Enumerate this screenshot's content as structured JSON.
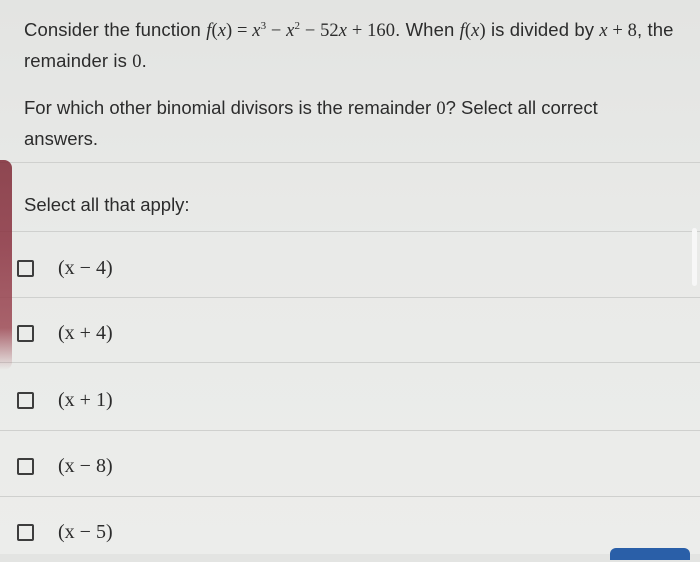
{
  "question": {
    "intro": "Consider the function",
    "function": "f(x) = x³ − x² − 52x + 160",
    "when": "When",
    "fx": "f(x)",
    "is_divided_by": "is divided",
    "by": "by",
    "divisor": "x + 8",
    "remainder_text": ", the remainder is",
    "zero": "0",
    "prompt_start": "For which other binomial divisors is the remainder",
    "prompt_zero": "0",
    "prompt_end": "? Select all correct answers."
  },
  "instruction": "Select all that apply:",
  "options": [
    {
      "label": "(x − 4)",
      "checked": false
    },
    {
      "label": "(x + 4)",
      "checked": false
    },
    {
      "label": "(x + 1)",
      "checked": false
    },
    {
      "label": "(x − 8)",
      "checked": false
    },
    {
      "label": "(x − 5)",
      "checked": false
    }
  ]
}
